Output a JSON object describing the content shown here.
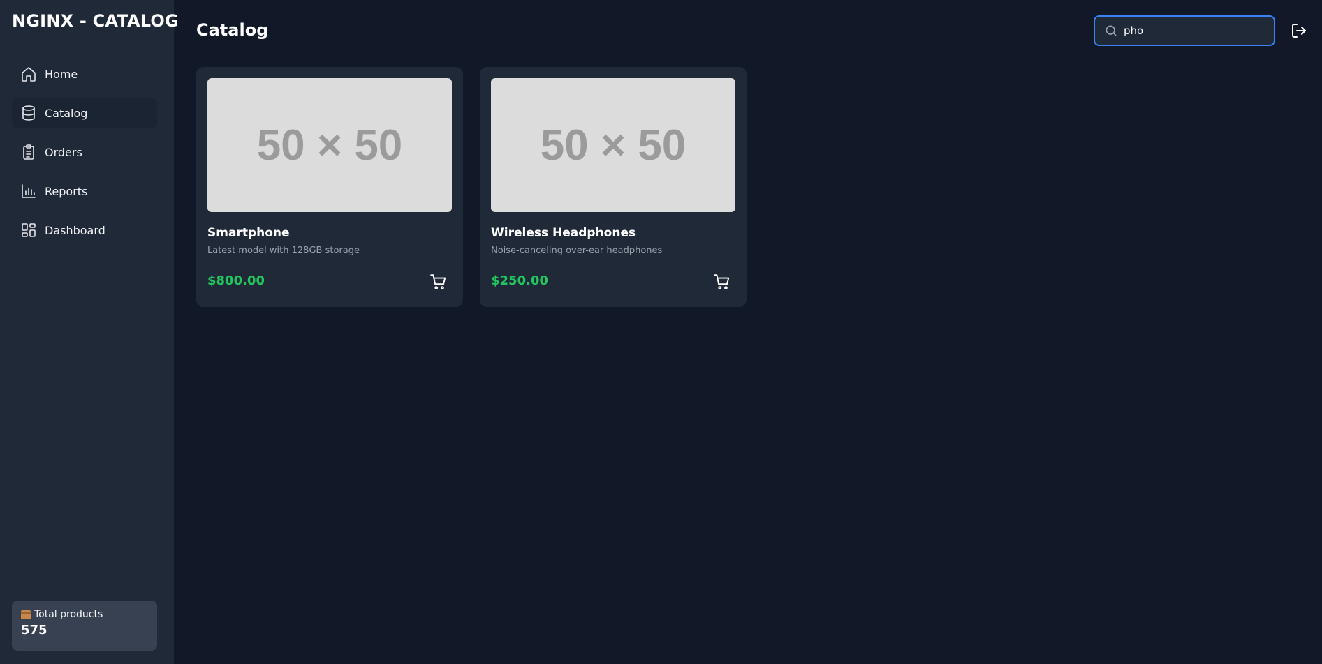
{
  "sidebar": {
    "brand": "NGINX - CATALOG",
    "items": [
      {
        "label": "Home",
        "icon": "home-icon"
      },
      {
        "label": "Catalog",
        "icon": "database-icon",
        "active": true
      },
      {
        "label": "Orders",
        "icon": "clipboard-list-icon"
      },
      {
        "label": "Reports",
        "icon": "bar-chart-icon"
      },
      {
        "label": "Dashboard",
        "icon": "layout-grid-icon"
      }
    ],
    "stats": {
      "label": "Total products",
      "value": "575",
      "icon": "package-icon"
    }
  },
  "header": {
    "title": "Catalog",
    "search": {
      "value": "pho",
      "icon": "search-icon"
    },
    "logout_icon": "logout-icon"
  },
  "products": [
    {
      "image_text": "50 × 50",
      "name": "Smartphone",
      "description": "Latest model with 128GB storage",
      "price": "$800.00"
    },
    {
      "image_text": "50 × 50",
      "name": "Wireless Headphones",
      "description": "Noise-canceling over-ear headphones",
      "price": "$250.00"
    }
  ],
  "colors": {
    "sidebar_bg": "#1f2937",
    "page_bg": "#111827",
    "accent": "#3b82f6",
    "price": "#22c55e"
  }
}
